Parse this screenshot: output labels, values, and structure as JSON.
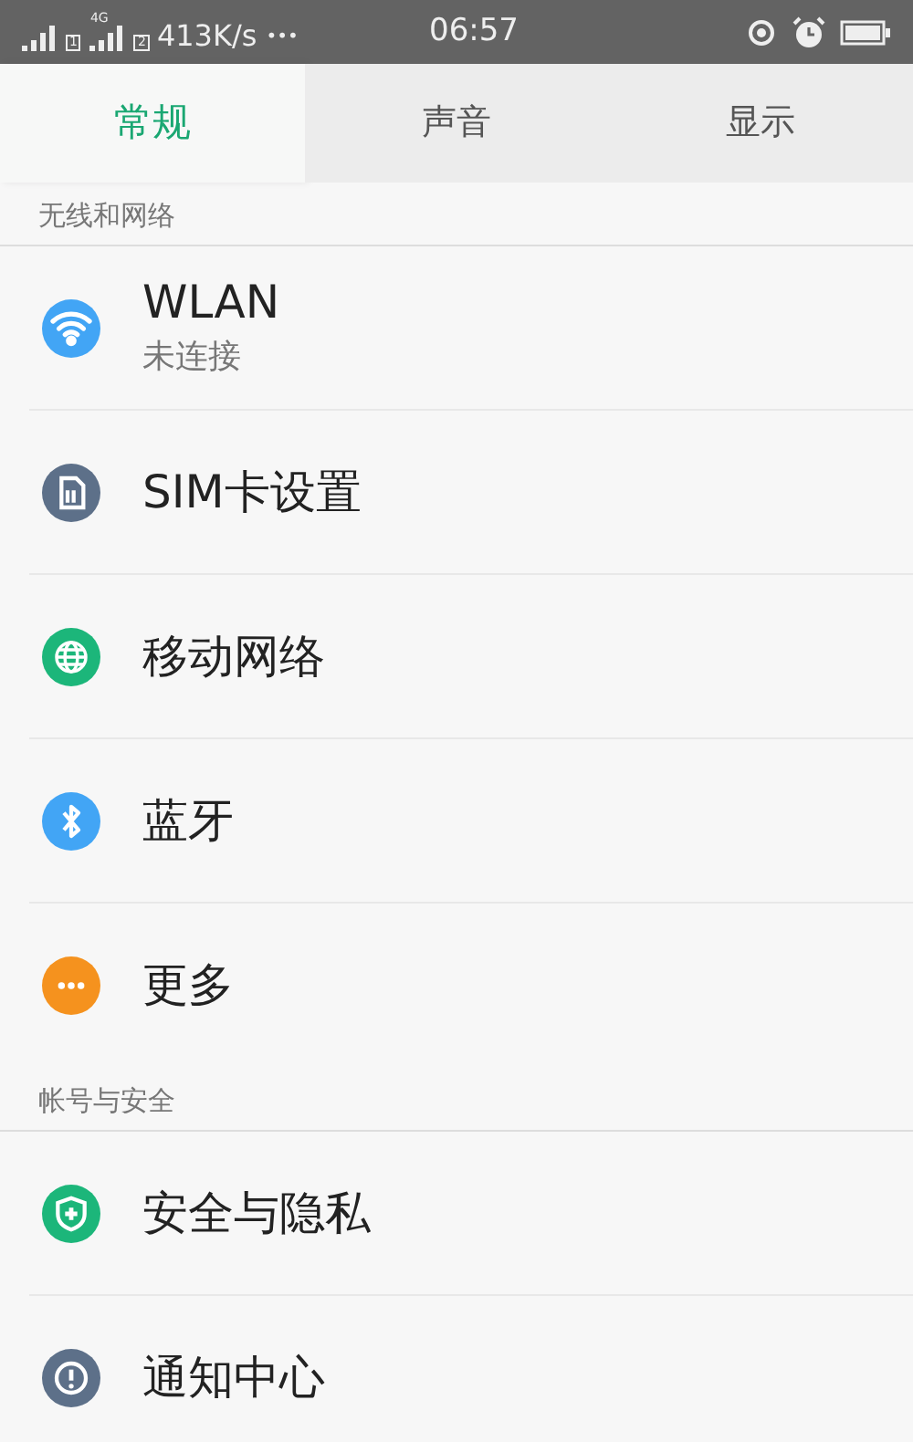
{
  "status_bar": {
    "sim1_label": "1",
    "network_type": "4G",
    "sim2_label": "2",
    "speed": "413K/s",
    "more": "•••",
    "time": "06:57"
  },
  "tabs": [
    {
      "label": "常规",
      "selected": true
    },
    {
      "label": "声音",
      "selected": false
    },
    {
      "label": "显示",
      "selected": false
    }
  ],
  "sections": [
    {
      "title": "无线和网络",
      "items": [
        {
          "label": "WLAN",
          "subtitle": "未连接",
          "kind": "wifi",
          "color": "#42a5f5"
        },
        {
          "label": "SIM卡设置",
          "kind": "sim",
          "color": "#5d7089"
        },
        {
          "label": "移动网络",
          "kind": "globe",
          "color": "#1cb67a"
        },
        {
          "label": "蓝牙",
          "kind": "bluetooth",
          "color": "#42a5f5"
        },
        {
          "label": "更多",
          "kind": "more",
          "color": "#f5921e"
        }
      ]
    },
    {
      "title": "帐号与安全",
      "items": [
        {
          "label": "安全与隐私",
          "kind": "shield",
          "color": "#1cb67a"
        },
        {
          "label": "通知中心",
          "kind": "alert",
          "color": "#5d7089"
        }
      ]
    }
  ]
}
